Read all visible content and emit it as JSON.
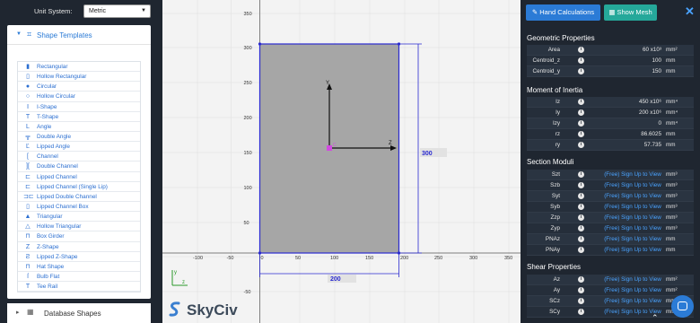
{
  "unit_system": {
    "label": "Unit System:",
    "value": "Metric"
  },
  "templates": {
    "title": "Shape Templates",
    "items": [
      {
        "label": "Rectangular",
        "icon": "rectangle-icon",
        "glyph": "▮"
      },
      {
        "label": "Hollow Rectangular",
        "icon": "hollow-rectangle-icon",
        "glyph": "▯"
      },
      {
        "label": "Circular",
        "icon": "circle-icon",
        "glyph": "●"
      },
      {
        "label": "Hollow Circular",
        "icon": "hollow-circle-icon",
        "glyph": "○"
      },
      {
        "label": "I-Shape",
        "icon": "i-shape-icon",
        "glyph": "Ⅰ"
      },
      {
        "label": "T-Shape",
        "icon": "t-shape-icon",
        "glyph": "T"
      },
      {
        "label": "Angle",
        "icon": "angle-icon",
        "glyph": "L"
      },
      {
        "label": "Double Angle",
        "icon": "double-angle-icon",
        "glyph": "╦"
      },
      {
        "label": "Lipped Angle",
        "icon": "lipped-angle-icon",
        "glyph": "Ľ"
      },
      {
        "label": "Channel",
        "icon": "channel-icon",
        "glyph": "["
      },
      {
        "label": "Double Channel",
        "icon": "double-channel-icon",
        "glyph": "]["
      },
      {
        "label": "Lipped Channel",
        "icon": "lipped-channel-icon",
        "glyph": "⊏"
      },
      {
        "label": "Lipped Channel (Single Lip)",
        "icon": "lipped-channel-single-lip-icon",
        "glyph": "⊏"
      },
      {
        "label": "Lipped Double Channel",
        "icon": "lipped-double-channel-icon",
        "glyph": "⊐⊏"
      },
      {
        "label": "Lipped Channel Box",
        "icon": "lipped-channel-box-icon",
        "glyph": "▯"
      },
      {
        "label": "Triangular",
        "icon": "triangle-icon",
        "glyph": "▲"
      },
      {
        "label": "Hollow Triangular",
        "icon": "hollow-triangle-icon",
        "glyph": "△"
      },
      {
        "label": "Box Girder",
        "icon": "box-girder-icon",
        "glyph": "⊓"
      },
      {
        "label": "Z-Shape",
        "icon": "z-shape-icon",
        "glyph": "Z"
      },
      {
        "label": "Lipped Z-Shape",
        "icon": "lipped-z-shape-icon",
        "glyph": "Ƨ"
      },
      {
        "label": "Hat Shape",
        "icon": "hat-shape-icon",
        "glyph": "⊓"
      },
      {
        "label": "Bulb Flat",
        "icon": "bulb-flat-icon",
        "glyph": "ſ"
      },
      {
        "label": "Tee Rail",
        "icon": "tee-rail-icon",
        "glyph": "T"
      }
    ]
  },
  "database": {
    "title": "Database Shapes"
  },
  "canvas": {
    "x_ticks": [
      "-100",
      "-50",
      "0",
      "50",
      "100",
      "150",
      "200",
      "250",
      "300",
      "350"
    ],
    "y_ticks": [
      "350",
      "300",
      "250",
      "200",
      "150",
      "100",
      "50",
      "0",
      "-50"
    ],
    "width_dim": "200",
    "height_dim": "300",
    "axis_y": "Y",
    "axis_z": "Z",
    "centroid_label": "C",
    "corner_y": "y",
    "corner_z": "z",
    "shape_fill": "#a6a6a6",
    "shape_stroke": "#2a2ad0"
  },
  "logo": {
    "text": "SkyCiv"
  },
  "toolbar": {
    "hand_calc": "Hand Calculations",
    "show_mesh": "Show Mesh",
    "hand_color": "#2b7bd6",
    "mesh_color": "#25a89a"
  },
  "sections": [
    {
      "title": "Geometric Properties",
      "rows": [
        {
          "lab": "Area",
          "val": "60 x10³",
          "unit": "mm²"
        },
        {
          "lab": "Centroid_z",
          "val": "100",
          "unit": "mm"
        },
        {
          "lab": "Centroid_y",
          "val": "150",
          "unit": "mm"
        }
      ]
    },
    {
      "title": "Moment of Inertia",
      "rows": [
        {
          "lab": "Iz",
          "val": "450 x10⁶",
          "unit": "mm⁴"
        },
        {
          "lab": "Iy",
          "val": "200 x10⁶",
          "unit": "mm⁴"
        },
        {
          "lab": "Izy",
          "val": "0",
          "unit": "mm⁴"
        },
        {
          "lab": "rz",
          "val": "86.6025",
          "unit": "mm"
        },
        {
          "lab": "ry",
          "val": "57.735",
          "unit": "mm"
        }
      ]
    },
    {
      "title": "Section Moduli",
      "rows": [
        {
          "lab": "Szt",
          "val": "(Free) Sign Up to View",
          "unit": "mm³",
          "link": true
        },
        {
          "lab": "Szb",
          "val": "(Free) Sign Up to View",
          "unit": "mm³",
          "link": true
        },
        {
          "lab": "Syt",
          "val": "(Free) Sign Up to View",
          "unit": "mm³",
          "link": true
        },
        {
          "lab": "Syb",
          "val": "(Free) Sign Up to View",
          "unit": "mm³",
          "link": true
        },
        {
          "lab": "Zzp",
          "val": "(Free) Sign Up to View",
          "unit": "mm³",
          "link": true
        },
        {
          "lab": "Zyp",
          "val": "(Free) Sign Up to View",
          "unit": "mm³",
          "link": true
        },
        {
          "lab": "PNAz",
          "val": "(Free) Sign Up to View",
          "unit": "mm",
          "link": true
        },
        {
          "lab": "PNAy",
          "val": "(Free) Sign Up to View",
          "unit": "mm",
          "link": true
        }
      ]
    },
    {
      "title": "Shear Properties",
      "rows": [
        {
          "lab": "Az",
          "val": "(Free) Sign Up to View",
          "unit": "mm²",
          "link": true
        },
        {
          "lab": "Ay",
          "val": "(Free) Sign Up to View",
          "unit": "mm²",
          "link": true
        },
        {
          "lab": "SCz",
          "val": "(Free) Sign Up to View",
          "unit": "mm",
          "link": true
        },
        {
          "lab": "SCy",
          "val": "(Free) Sign Up to View",
          "unit": "mm",
          "link": true
        }
      ]
    }
  ]
}
